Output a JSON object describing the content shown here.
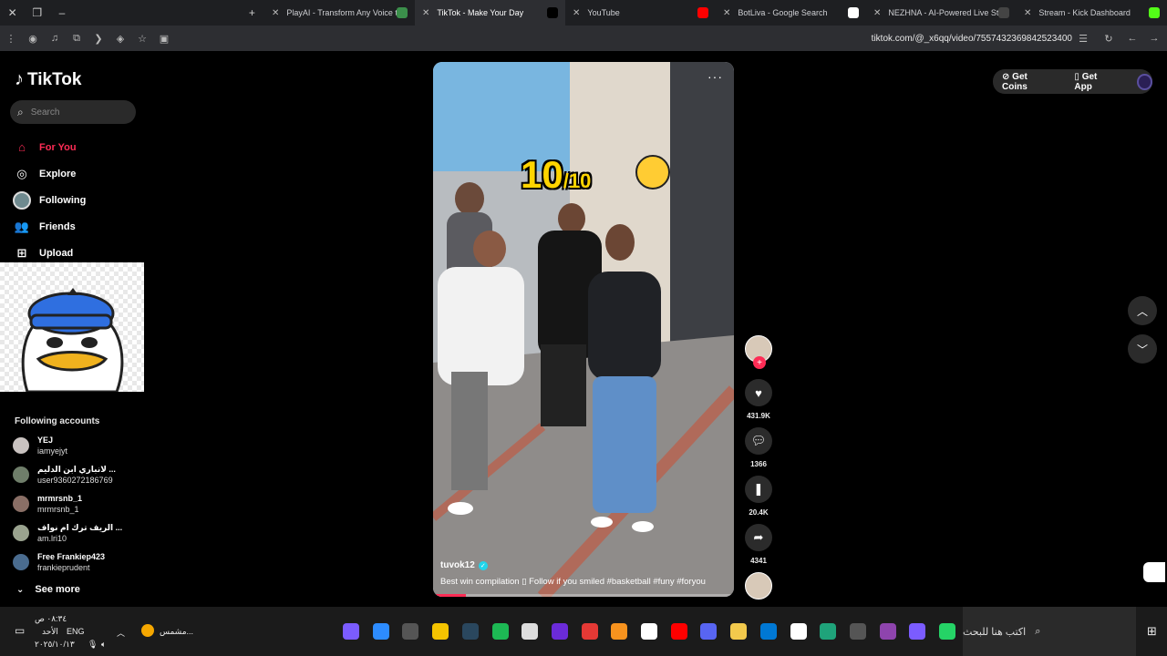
{
  "browser": {
    "tabs": [
      {
        "title": "PlayAI - Transform Any Voice to",
        "fav_color": "#3b8f4b",
        "active": false
      },
      {
        "title": "TikTok - Make Your Day",
        "fav_color": "#000000",
        "active": true
      },
      {
        "title": "YouTube",
        "fav_color": "#ff0000",
        "active": false
      },
      {
        "title": "BotLiva - Google Search",
        "fav_color": "#ffffff",
        "active": false
      },
      {
        "title": "NEZHNA - AI-Powered Live Stre",
        "fav_color": "#444444",
        "active": false
      },
      {
        "title": "Stream - Kick Dashboard",
        "fav_color": "#53fc18",
        "active": false
      }
    ],
    "url": "tiktok.com/@_x6qq/video/7557432369842523400"
  },
  "sidebar": {
    "logo": "TikTok",
    "search_placeholder": "Search",
    "nav": [
      {
        "label": "For You",
        "icon": "home-icon",
        "glyph": "⌂",
        "active": true
      },
      {
        "label": "Explore",
        "icon": "compass-icon",
        "glyph": "◎",
        "active": false
      },
      {
        "label": "Following",
        "icon": "following-avatar",
        "glyph": "",
        "active": false
      },
      {
        "label": "Friends",
        "icon": "friends-icon",
        "glyph": "👥",
        "active": false
      },
      {
        "label": "Upload",
        "icon": "upload-icon",
        "glyph": "⊞",
        "active": false
      }
    ],
    "following_title": "Following accounts",
    "accounts": [
      {
        "name": "YEJ",
        "handle": "iamyejyt",
        "color": "#c9c2c0"
      },
      {
        "name": "لانباري ابن الدليم ...",
        "handle": "user9360272186769",
        "color": "#6f7e6a"
      },
      {
        "name": "mrmrsnb_1",
        "handle": "mrmrsnb_1",
        "color": "#8a6f66"
      },
      {
        "name": "الريف ترك ام نواف ...",
        "handle": "am.lri10",
        "color": "#9aa38f"
      },
      {
        "name": "Free Frankiep423",
        "handle": "frankieprudent",
        "color": "#4a6c8f"
      }
    ],
    "see_more": "See more"
  },
  "video": {
    "rating_big": "10",
    "rating_small": "/10",
    "author": "tuvok12",
    "caption": "Best win compilation ▯ Follow if you smiled #basketball  #funy  #foryou",
    "progress": 0.11
  },
  "actions": {
    "likes": "431.9K",
    "comments": "1366",
    "saves": "20.4K",
    "shares": "4341"
  },
  "topbar": {
    "coins": "Get Coins",
    "app": "Get App"
  },
  "taskbar": {
    "time": "٠٨:٣٤ ص",
    "day": "الأحد",
    "date": "٢٠٢٥/١٠/١٣",
    "lang": "ENG",
    "weather": "مشمس...",
    "search_placeholder": "اكتب هنا للبحث"
  }
}
